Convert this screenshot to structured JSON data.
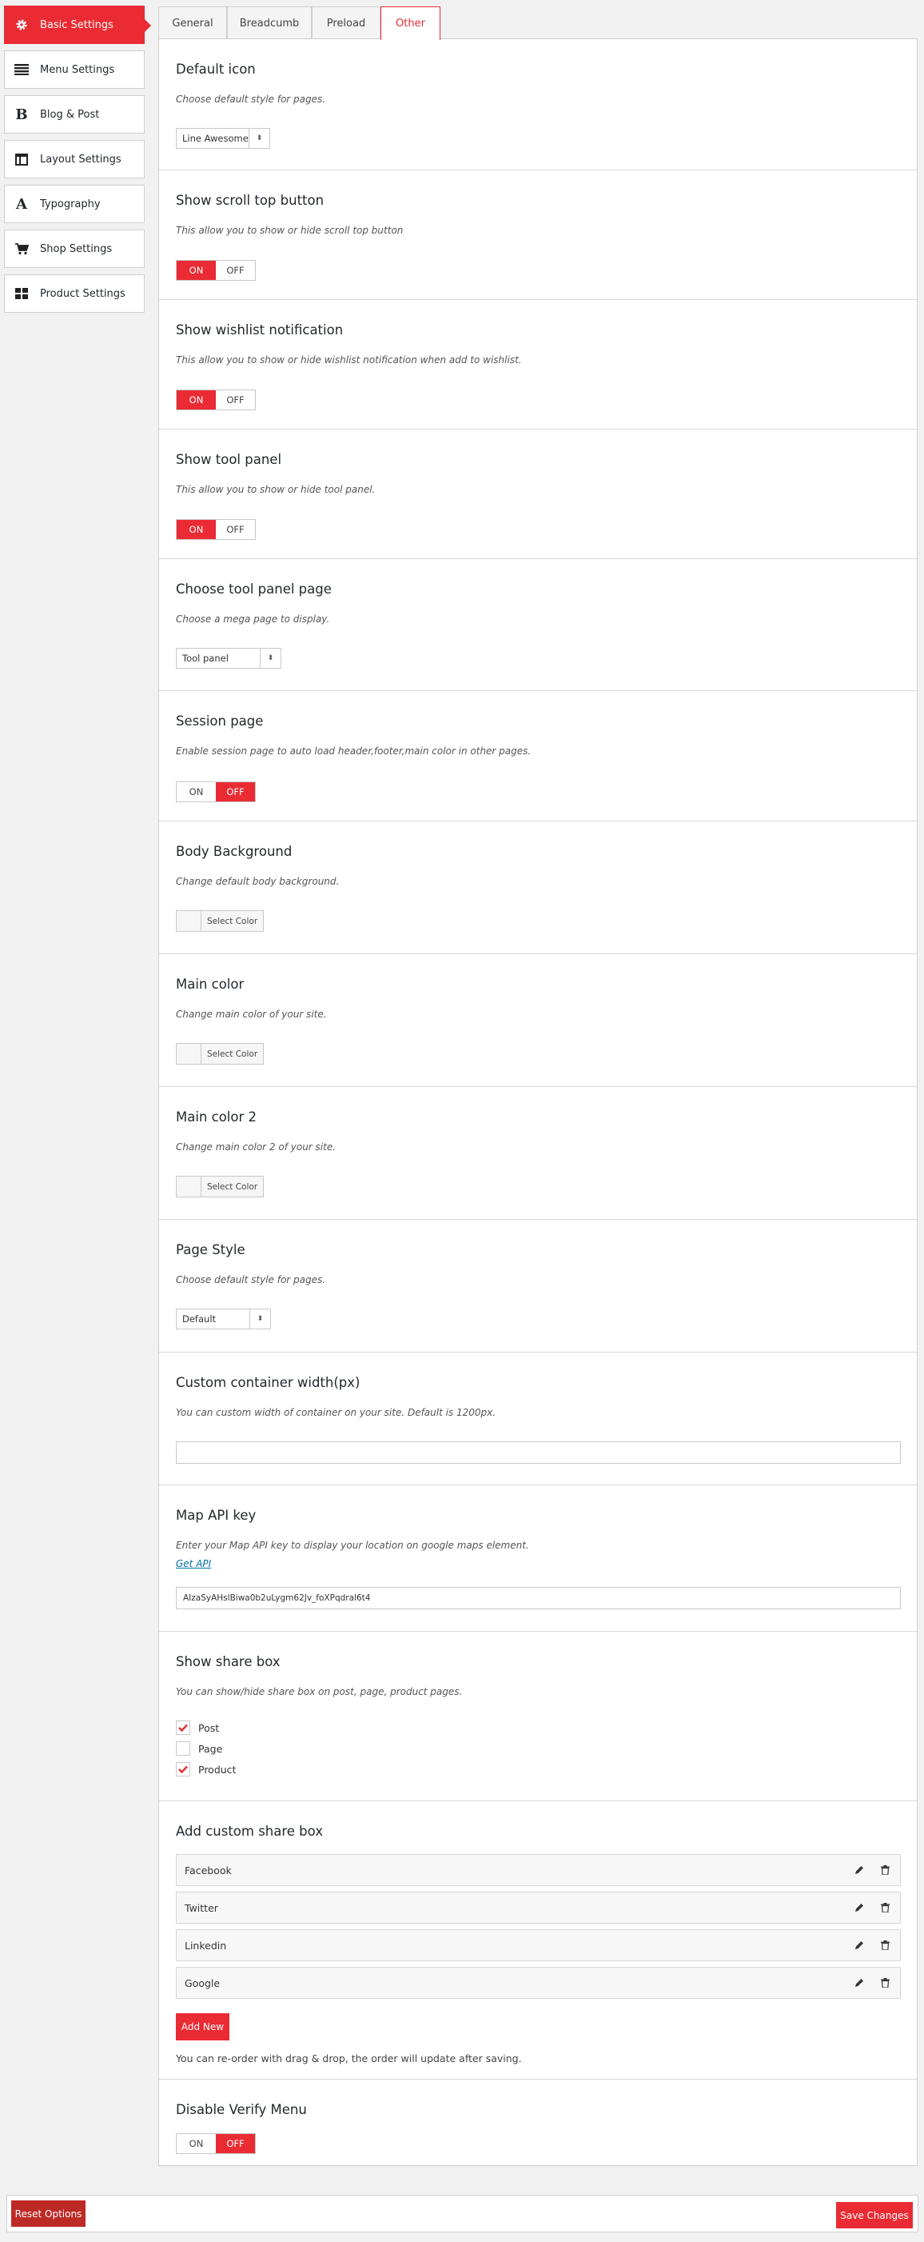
{
  "sidebar": {
    "items": [
      {
        "label": "Basic Settings",
        "icon": "gear-icon"
      },
      {
        "label": "Menu Settings",
        "icon": "menu-lines-icon"
      },
      {
        "label": "Blog & Post",
        "icon": "bold-b-icon"
      },
      {
        "label": "Layout Settings",
        "icon": "layout-icon"
      },
      {
        "label": "Typography",
        "icon": "typography-a-icon"
      },
      {
        "label": "Shop Settings",
        "icon": "cart-icon"
      },
      {
        "label": "Product Settings",
        "icon": "grid-icon"
      }
    ]
  },
  "tabs": [
    {
      "label": "General"
    },
    {
      "label": "Breadcumb"
    },
    {
      "label": "Preload"
    },
    {
      "label": "Other"
    }
  ],
  "sections": {
    "default_icon": {
      "title": "Default icon",
      "desc": "Choose default style for pages.",
      "value": "Line Awesome"
    },
    "scroll_top": {
      "title": "Show scroll top button",
      "desc": "This allow you to show or hide scroll top button",
      "on": "ON",
      "off": "OFF"
    },
    "wishlist": {
      "title": "Show wishlist notification",
      "desc": "This allow you to show or hide wishlist notification when add to wishlist.",
      "on": "ON",
      "off": "OFF"
    },
    "tool_panel": {
      "title": "Show tool panel",
      "desc": "This allow you to show or hide tool panel.",
      "on": "ON",
      "off": "OFF"
    },
    "tool_panel_page": {
      "title": "Choose tool panel page",
      "desc": "Choose a mega page to display.",
      "value": "Tool panel"
    },
    "session_page": {
      "title": "Session page",
      "desc": "Enable session page to auto load header,footer,main color in other pages.",
      "on": "ON",
      "off": "OFF"
    },
    "body_bg": {
      "title": "Body Background",
      "desc": "Change default body background.",
      "button": "Select Color"
    },
    "main_color": {
      "title": "Main color",
      "desc": "Change main color of your site.",
      "button": "Select Color"
    },
    "main_color2": {
      "title": "Main color 2",
      "desc": "Change main color 2 of your site.",
      "button": "Select Color"
    },
    "page_style": {
      "title": "Page Style",
      "desc": "Choose default style for pages.",
      "value": "Default"
    },
    "container_width": {
      "title": "Custom container width(px)",
      "desc": "You can custom width of container on your site. Default is 1200px.",
      "value": ""
    },
    "map_api": {
      "title": "Map API key",
      "desc": "Enter your Map API key to display your location on google maps element.",
      "link": "Get API",
      "value": "AIzaSyAHslBiwa0b2uLygm62Jv_foXPqdral6t4"
    },
    "share_box": {
      "title": "Show share box",
      "desc": "You can show/hide share box on post, page, product pages.",
      "options": [
        {
          "label": "Post",
          "checked": true
        },
        {
          "label": "Page",
          "checked": false
        },
        {
          "label": "Product",
          "checked": true
        }
      ]
    },
    "custom_share": {
      "title": "Add custom share box",
      "items": [
        {
          "label": "Facebook"
        },
        {
          "label": "Twitter"
        },
        {
          "label": "Linkedin"
        },
        {
          "label": "Google"
        }
      ],
      "add_label": "Add New",
      "note": "You can re-order with drag & drop, the order will update after saving."
    },
    "verify_menu": {
      "title": "Disable Verify Menu",
      "on": "ON",
      "off": "OFF"
    }
  },
  "footer": {
    "reset_label": "Reset Options",
    "save_label": "Save Changes"
  },
  "colors": {
    "accent": "#ea2b33",
    "reset": "#bd2a26"
  }
}
